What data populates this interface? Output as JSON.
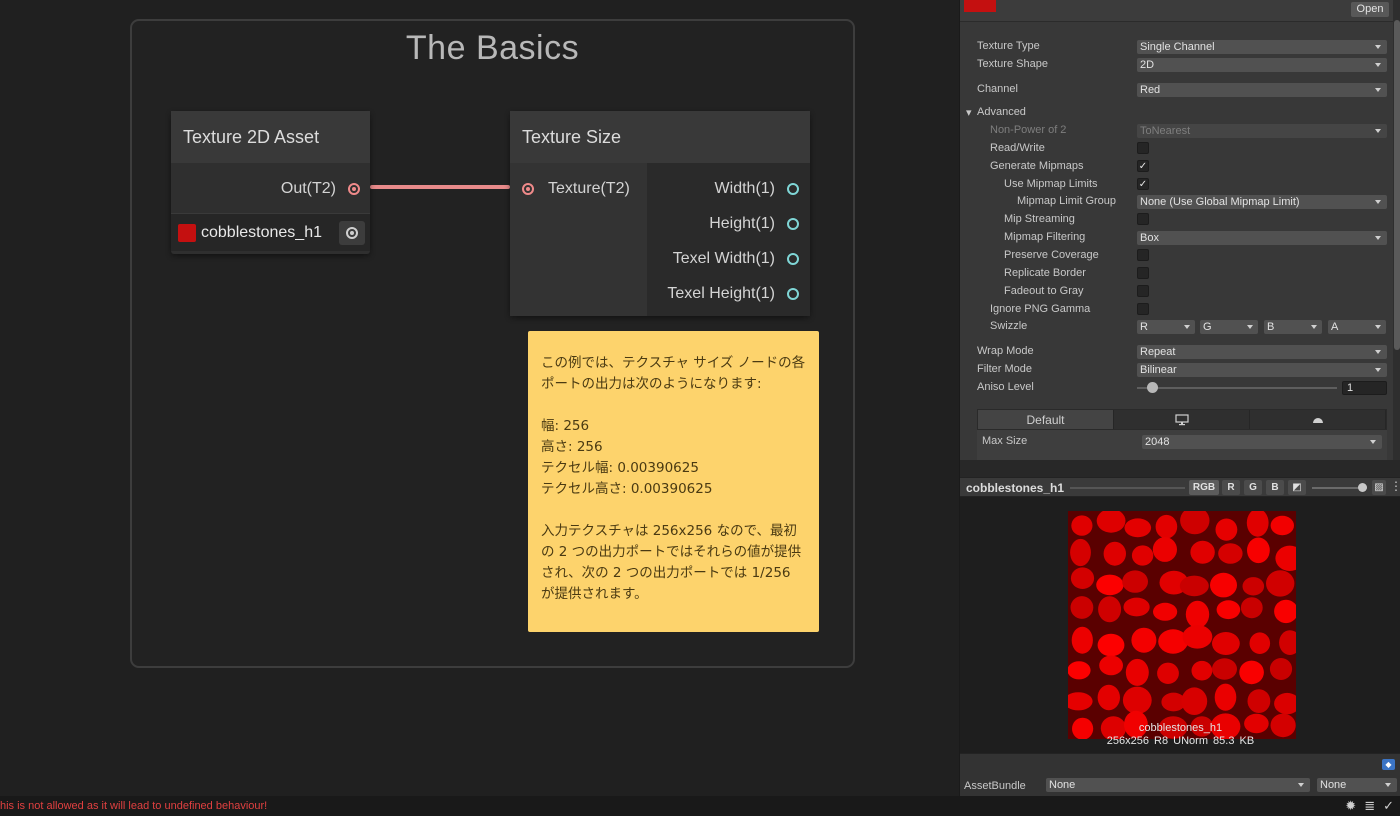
{
  "graph": {
    "group_title": "The Basics",
    "asset_node": {
      "title": "Texture 2D Asset",
      "out_port": "Out(T2)",
      "texture_name": "cobblestones_h1"
    },
    "size_node": {
      "title": "Texture Size",
      "in_port": "Texture(T2)",
      "out_ports": [
        "Width(1)",
        "Height(1)",
        "Texel Width(1)",
        "Texel Height(1)"
      ]
    },
    "sticky_note": {
      "para1": "この例では、テクスチャ サイズ ノードの各ポートの出力は次のようになります:",
      "lines": [
        "幅: 256",
        "高さ: 256",
        "テクセル幅: 0.00390625",
        "テクセル高さ: 0.00390625"
      ],
      "para2": "入力テクスチャは 256x256 なので、最初の 2 つの出力ポートではそれらの値が提供され、次の 2 つの出力ポートでは 1/256 が提供されます。"
    }
  },
  "status_bar": {
    "message": "his is not allowed as it will lead to undefined behaviour!"
  },
  "inspector": {
    "open_button": "Open",
    "texture_type": {
      "label": "Texture Type",
      "value": "Single Channel"
    },
    "texture_shape": {
      "label": "Texture Shape",
      "value": "2D"
    },
    "channel": {
      "label": "Channel",
      "value": "Red"
    },
    "advanced": "Advanced",
    "non_power_of_2": {
      "label": "Non-Power of 2",
      "value": "ToNearest"
    },
    "read_write": {
      "label": "Read/Write",
      "checked": false
    },
    "generate_mipmaps": {
      "label": "Generate Mipmaps",
      "checked": true
    },
    "use_mipmap_limits": {
      "label": "Use Mipmap Limits",
      "checked": true
    },
    "mipmap_limit_group": {
      "label": "Mipmap Limit Group",
      "value": "None (Use Global Mipmap Limit)"
    },
    "mip_streaming": {
      "label": "Mip Streaming",
      "checked": false
    },
    "mipmap_filtering": {
      "label": "Mipmap Filtering",
      "value": "Box"
    },
    "preserve_coverage": {
      "label": "Preserve Coverage",
      "checked": false
    },
    "replicate_border": {
      "label": "Replicate Border",
      "checked": false
    },
    "fadeout_to_gray": {
      "label": "Fadeout to Gray",
      "checked": false
    },
    "ignore_png_gamma": {
      "label": "Ignore PNG Gamma",
      "checked": false
    },
    "swizzle": {
      "label": "Swizzle",
      "values": [
        "R",
        "G",
        "B",
        "A"
      ]
    },
    "wrap_mode": {
      "label": "Wrap Mode",
      "value": "Repeat"
    },
    "filter_mode": {
      "label": "Filter Mode",
      "value": "Bilinear"
    },
    "aniso_level": {
      "label": "Aniso Level",
      "value": "1"
    },
    "platform_tabs": {
      "default": "Default"
    },
    "max_size": {
      "label": "Max Size",
      "value": "2048"
    }
  },
  "preview": {
    "title": "cobblestones_h1",
    "channels": [
      "RGB",
      "R",
      "G",
      "B"
    ],
    "name": "cobblestones_h1",
    "info": "256x256  R8 UNorm  85.3 KB"
  },
  "asset_bundle": {
    "label": "AssetBundle",
    "name": "None",
    "variant": "None"
  },
  "colors": {
    "sticky": "#fdd36c",
    "texture": "#c41010",
    "wire": "#e88a8a",
    "port_out": "#7fd6d6"
  }
}
